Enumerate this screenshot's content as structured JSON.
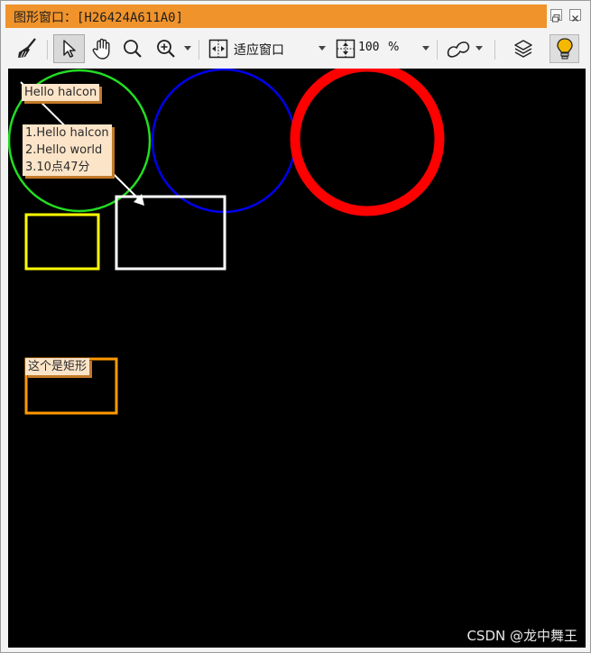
{
  "window": {
    "title": "图形窗口：[H26424A611A0]",
    "restore_icon": "restore-icon",
    "close_icon": "close-icon",
    "accent": "#f0932b"
  },
  "toolbar": {
    "fit_label": "适应窗口",
    "zoom_value": "100",
    "zoom_unit": "%",
    "icons": [
      "broom-icon",
      "pointer-icon",
      "pan-hand-icon",
      "magnifier-icon",
      "zoom-in-icon",
      "fit-window-icon",
      "zoom-percent-icon",
      "draw-shape-icon",
      "layers-icon",
      "lightbulb-icon"
    ]
  },
  "canvas": {
    "background": "#000000",
    "labels": {
      "hello": "Hello halcon",
      "multiline": "1.Hello halcon\n2.Hello world\n3.10点47分",
      "rect": "这个是矩形"
    },
    "colors": {
      "green": "#22dd22",
      "blue": "#0000ee",
      "red": "#ff0000",
      "yellow": "#ffff00",
      "white": "#ffffff",
      "orange": "#ff9900"
    }
  },
  "watermark": "CSDN @龙中舞王"
}
